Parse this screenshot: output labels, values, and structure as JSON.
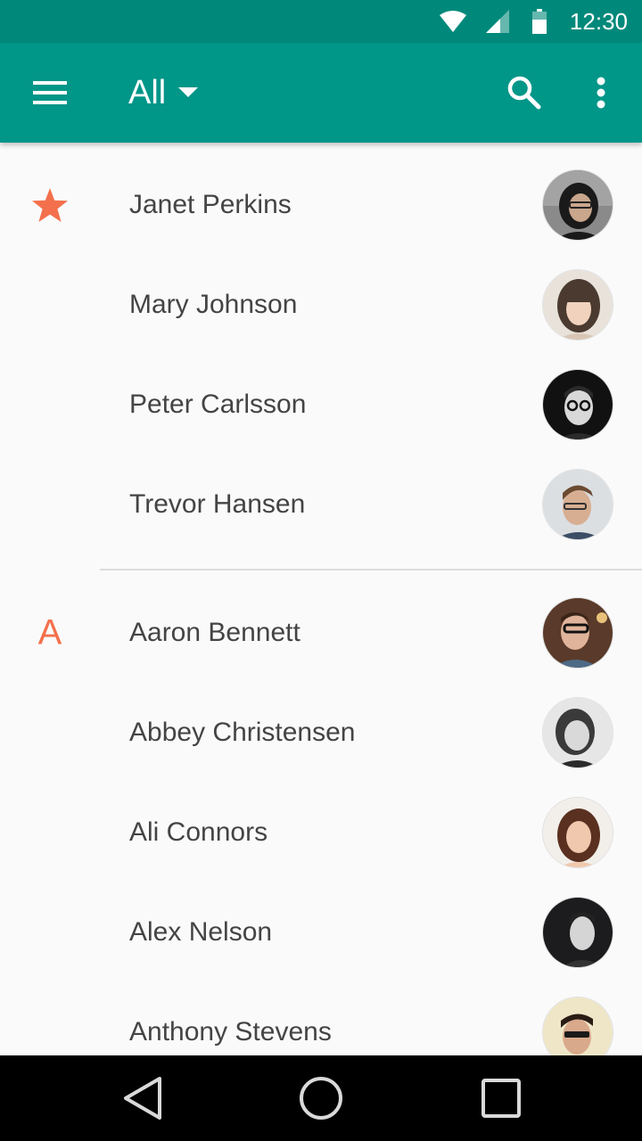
{
  "status_bar": {
    "time": "12:30",
    "icons": [
      "wifi-icon",
      "cell-signal-icon",
      "battery-icon"
    ]
  },
  "app_bar": {
    "menu_icon": "menu-icon",
    "filter_label": "All",
    "filter_icon": "arrow-drop-down-icon",
    "search_icon": "search-icon",
    "more_icon": "more-vert-icon",
    "background_color": "#009688",
    "status_color": "#00897b"
  },
  "contacts": {
    "favorites_marker": "star-icon",
    "section_letter": "A",
    "accent_color": "#f4704c",
    "favorites": [
      {
        "name": "Janet Perkins"
      },
      {
        "name": "Mary Johnson"
      },
      {
        "name": "Peter Carlsson"
      },
      {
        "name": "Trevor Hansen"
      }
    ],
    "section_a": [
      {
        "name": "Aaron Bennett"
      },
      {
        "name": "Abbey Christensen"
      },
      {
        "name": "Ali Connors"
      },
      {
        "name": "Alex Nelson"
      },
      {
        "name": "Anthony Stevens"
      }
    ]
  },
  "nav_bar": {
    "buttons": [
      "back-icon",
      "home-icon",
      "recents-icon"
    ]
  }
}
